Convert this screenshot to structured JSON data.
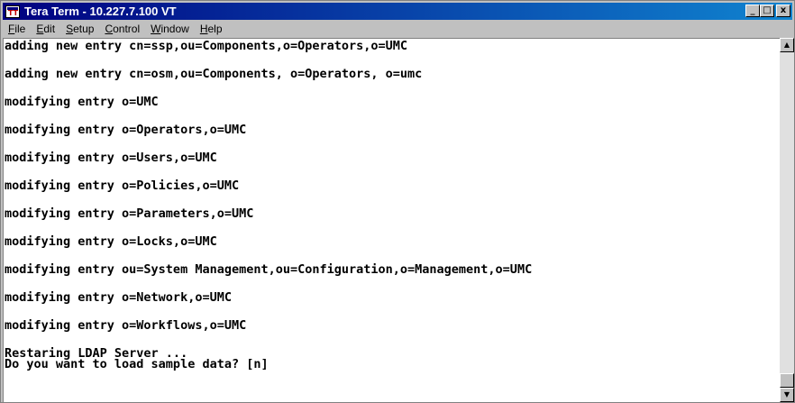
{
  "window": {
    "title": "Tera Term - 10.227.7.100 VT"
  },
  "title_buttons": {
    "minimize": "_",
    "maximize": "□",
    "close": "x"
  },
  "menu": [
    {
      "label": "File",
      "ul": "F",
      "rest": "ile"
    },
    {
      "label": "Edit",
      "ul": "E",
      "rest": "dit"
    },
    {
      "label": "Setup",
      "ul": "S",
      "rest": "etup"
    },
    {
      "label": "Control",
      "ul": "C",
      "rest": "ontrol"
    },
    {
      "label": "Window",
      "ul": "W",
      "rest": "indow"
    },
    {
      "label": "Help",
      "ul": "H",
      "rest": "elp"
    }
  ],
  "terminal": {
    "lines": [
      "adding new entry cn=ssp,ou=Components,o=Operators,o=UMC",
      "adding new entry cn=osm,ou=Components, o=Operators, o=umc",
      "modifying entry o=UMC",
      "modifying entry o=Operators,o=UMC",
      "modifying entry o=Users,o=UMC",
      "modifying entry o=Policies,o=UMC",
      "modifying entry o=Parameters,o=UMC",
      "modifying entry o=Locks,o=UMC",
      "modifying entry ou=System Management,ou=Configuration,o=Management,o=UMC",
      "modifying entry o=Network,o=UMC",
      "modifying entry o=Workflows,o=UMC",
      "Restaring LDAP Server ...",
      "Do you want to load sample data? [n]"
    ]
  },
  "scrollbar": {
    "up_arrow": "▲",
    "down_arrow": "▼",
    "position_fraction": 1.0
  },
  "colors": {
    "title_bar_start": "#000080",
    "title_bar_end": "#1084d0",
    "terminal_bg": "#ffffff",
    "terminal_fg": "#000000",
    "chrome": "#c0c0c0"
  }
}
